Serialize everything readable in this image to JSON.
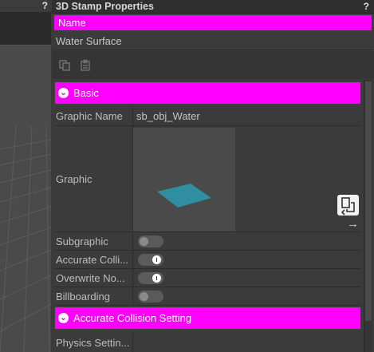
{
  "viewport": {
    "help_glyph": "?"
  },
  "panel": {
    "title": "3D Stamp Properties",
    "help_glyph": "?",
    "name_header": "Name",
    "name_value": "Water Surface",
    "icons": [
      "copy-icon",
      "paste-icon"
    ]
  },
  "sections": {
    "basic": "Basic",
    "collision": "Accurate Collision Setting"
  },
  "rows": {
    "graphic_name": {
      "label": "Graphic Name",
      "value": "sb_obj_Water"
    },
    "graphic": {
      "label": "Graphic"
    },
    "subgraphic": {
      "label": "Subgraphic",
      "on": false
    },
    "accurate": {
      "label": "Accurate Colli...",
      "on": true
    },
    "overwrite": {
      "label": "Overwrite No...",
      "on": true
    },
    "billboarding": {
      "label": "Billboarding",
      "on": false
    },
    "physics": {
      "label": "Physics Settin..."
    }
  },
  "colors": {
    "accent": "#ff00ff",
    "water": "#2a9bb0"
  }
}
